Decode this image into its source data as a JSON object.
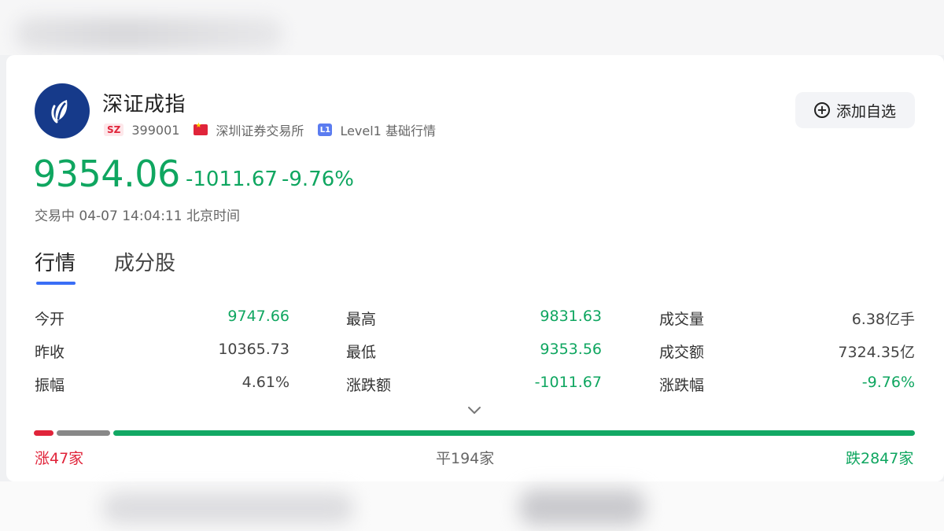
{
  "header": {
    "name": "深证成指",
    "market_badge": "SZ",
    "code": "399001",
    "exchange": "深圳证券交易所",
    "level_badge": "L1",
    "level_text": "Level1 基础行情",
    "add_button_label": "添加自选"
  },
  "quote": {
    "price": "9354.06",
    "change": "-1011.67",
    "change_pct": "-9.76%",
    "status_time": "交易中 04-07 14:04:11 北京时间"
  },
  "tabs": [
    {
      "label": "行情",
      "active": true
    },
    {
      "label": "成分股",
      "active": false
    }
  ],
  "stats": {
    "open": {
      "label": "今开",
      "value": "9747.66"
    },
    "prev_close": {
      "label": "昨收",
      "value": "10365.73"
    },
    "amplitude": {
      "label": "振幅",
      "value": "4.61%"
    },
    "high": {
      "label": "最高",
      "value": "9831.63"
    },
    "low": {
      "label": "最低",
      "value": "9353.56"
    },
    "change_amt": {
      "label": "涨跌额",
      "value": "-1011.67"
    },
    "volume": {
      "label": "成交量",
      "value": "6.38亿手"
    },
    "turnover": {
      "label": "成交额",
      "value": "7324.35亿"
    },
    "change_rate": {
      "label": "涨跌幅",
      "value": "-9.76%"
    }
  },
  "breadth": {
    "up_label": "涨47家",
    "flat_label": "平194家",
    "down_label": "跌2847家",
    "up": 47,
    "flat": 194,
    "down": 2847
  },
  "colors": {
    "up": "#e0243a",
    "down": "#0fa660",
    "flat": "#888888",
    "accent": "#3a6ef6",
    "logo": "#163a8a"
  }
}
